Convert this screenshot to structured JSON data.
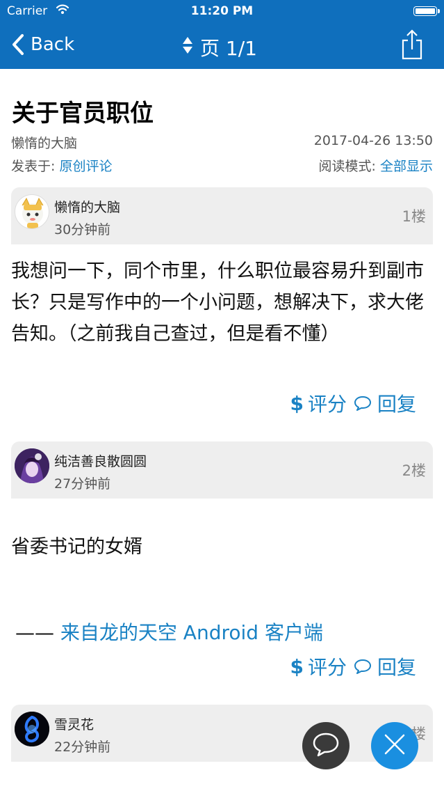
{
  "status": {
    "carrier": "Carrier",
    "time": "11:20 PM"
  },
  "nav": {
    "back_label": "Back",
    "page_label": "页 1/1"
  },
  "thread": {
    "title": "关于官员职位",
    "author": "懒惰的大脑",
    "datetime": "2017-04-26 13:50",
    "posted_in_label": "发表于:",
    "forum": "原创评论",
    "read_mode_label": "阅读模式:",
    "read_mode": "全部显示"
  },
  "posts": [
    {
      "user": "懒惰的大脑",
      "time": "30分钟前",
      "floor": "1楼",
      "body": "我想问一下，同个市里，什么职位最容易升到副市长？只是写作中的一个小问题，想解决下，求大佬告知。（之前我自己查过，但是看不懂）",
      "rate_label": "评分",
      "reply_label": "回复"
    },
    {
      "user": "纯洁善良散圆圆",
      "time": "27分钟前",
      "floor": "2楼",
      "body": "省委书记的女婿",
      "signature_dash": "——",
      "signature_source": "来自龙的天空 Android 客户端",
      "rate_label": "评分",
      "reply_label": "回复"
    },
    {
      "user": "雪灵花",
      "time": "22分钟前",
      "floor": "3楼"
    }
  ],
  "colors": {
    "nav_bg": "#0f6fbd",
    "accent": "#1a82c4",
    "fab_close": "#1a8fe0",
    "fab_chat": "#3a3a3a"
  },
  "icons": [
    "wifi-icon",
    "battery-icon",
    "back-chevron-icon",
    "sort-arrows-icon",
    "share-icon",
    "comment-icon",
    "chat-bubble-icon",
    "close-icon"
  ]
}
